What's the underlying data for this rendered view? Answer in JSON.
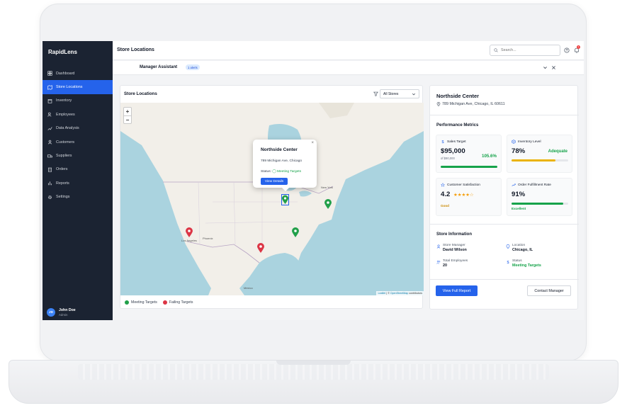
{
  "app": {
    "name": "RapidLens"
  },
  "sidebar": {
    "items": [
      {
        "label": "Dashboard",
        "icon": "dashboard-icon",
        "active": false
      },
      {
        "label": "Store Locations",
        "icon": "map-icon",
        "active": true
      },
      {
        "label": "Inventory",
        "icon": "box-icon",
        "active": false
      },
      {
        "label": "Employees",
        "icon": "users-icon",
        "active": false
      },
      {
        "label": "Data Analysis",
        "icon": "chart-icon",
        "active": false
      },
      {
        "label": "Customers",
        "icon": "customer-icon",
        "active": false
      },
      {
        "label": "Suppliers",
        "icon": "truck-icon",
        "active": false
      },
      {
        "label": "Orders",
        "icon": "clipboard-icon",
        "active": false
      },
      {
        "label": "Reports",
        "icon": "bar-chart-icon",
        "active": false
      },
      {
        "label": "Settings",
        "icon": "gear-icon",
        "active": false
      }
    ],
    "user": {
      "initials": "JD",
      "name": "John Doe",
      "role": "Admin"
    }
  },
  "header": {
    "title": "Store Locations",
    "search_placeholder": "Search...",
    "notification_count": "1"
  },
  "assistant": {
    "title": "Manager Assistant",
    "badge": "1 alerts"
  },
  "map_card": {
    "title": "Store Locations",
    "filter_value": "All Stores",
    "zoom_in": "+",
    "zoom_out": "−",
    "attribution_leaflet": "Leaflet",
    "attribution_sep": " | © ",
    "attribution_osm": "OpenStreetMap",
    "attribution_tail": " contributors",
    "popup": {
      "title": "Northside Center",
      "address": "789 Michigan Ave, Chicago",
      "status_label": "Status:",
      "status_value": "Meeting Targets",
      "button": "View Details",
      "close": "×"
    },
    "map_labels": {
      "new_york": "New York",
      "los_angeles": "Los Angeles",
      "phoenix": "Phoenix",
      "mexico": "México"
    },
    "legend": [
      {
        "label": "Meeting Targets",
        "color": "#22a04a"
      },
      {
        "label": "Failing Targets",
        "color": "#dc3545"
      }
    ]
  },
  "details": {
    "store_name": "Northside Center",
    "address": "789 Michigan Ave, Chicago, IL 60611",
    "performance_title": "Performance Metrics",
    "metrics": {
      "sales": {
        "label": "Sales Target",
        "value": "$95,000",
        "sub": "of $90,000",
        "pct": "105.6%",
        "progress": 1.0
      },
      "inventory": {
        "label": "Inventory Level",
        "value": "78%",
        "tag": "Adequate",
        "progress": 0.78
      },
      "satisfaction": {
        "label": "Customer Satisfaction",
        "value": "4.2",
        "rating": "Good",
        "stars": 4
      },
      "fulfillment": {
        "label": "Order Fulfillment Rate",
        "value": "91%",
        "rating": "Excellent",
        "progress": 0.91
      }
    },
    "info_title": "Store Information",
    "info": {
      "manager_label": "Store Manager",
      "manager_value": "David Wilson",
      "location_label": "Location",
      "location_value": "Chicago, IL",
      "employees_label": "Total Employees",
      "employees_value": "20",
      "status_label": "Status",
      "status_value": "Meeting Targets"
    },
    "btn_report": "View Full Report",
    "btn_contact": "Contact Manager"
  },
  "colors": {
    "accent": "#2563eb",
    "success": "#16a34a",
    "warning": "#eab308",
    "sidebar": "#1b2332"
  }
}
